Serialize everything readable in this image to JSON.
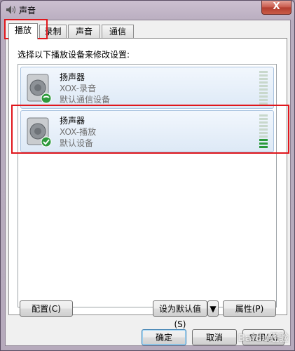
{
  "window": {
    "title": "声音",
    "close_glyph": "X"
  },
  "tabs": [
    {
      "label": "播放",
      "active": true
    },
    {
      "label": "录制",
      "active": false
    },
    {
      "label": "声音",
      "active": false
    },
    {
      "label": "通信",
      "active": false
    }
  ],
  "instruction": "选择以下播放设备来修改设置:",
  "devices": [
    {
      "name": "扬声器",
      "sub": "XOX-录音",
      "status": "默认通信设备",
      "badge": "phone-icon",
      "level": 0
    },
    {
      "name": "扬声器",
      "sub": "XOX-播放",
      "status": "默认设备",
      "badge": "check-icon",
      "level": 3
    }
  ],
  "buttons": {
    "configure": "配置(C)",
    "set_default": "设为默认值(S)",
    "properties": "属性(P)",
    "ok": "确定",
    "cancel": "取消",
    "apply": "应用(A)"
  },
  "watermark": "Baidu经验",
  "colors": {
    "highlight": "#e0161c",
    "meter_on": "#2b9a3c",
    "meter_off": "#c8d8cc"
  }
}
